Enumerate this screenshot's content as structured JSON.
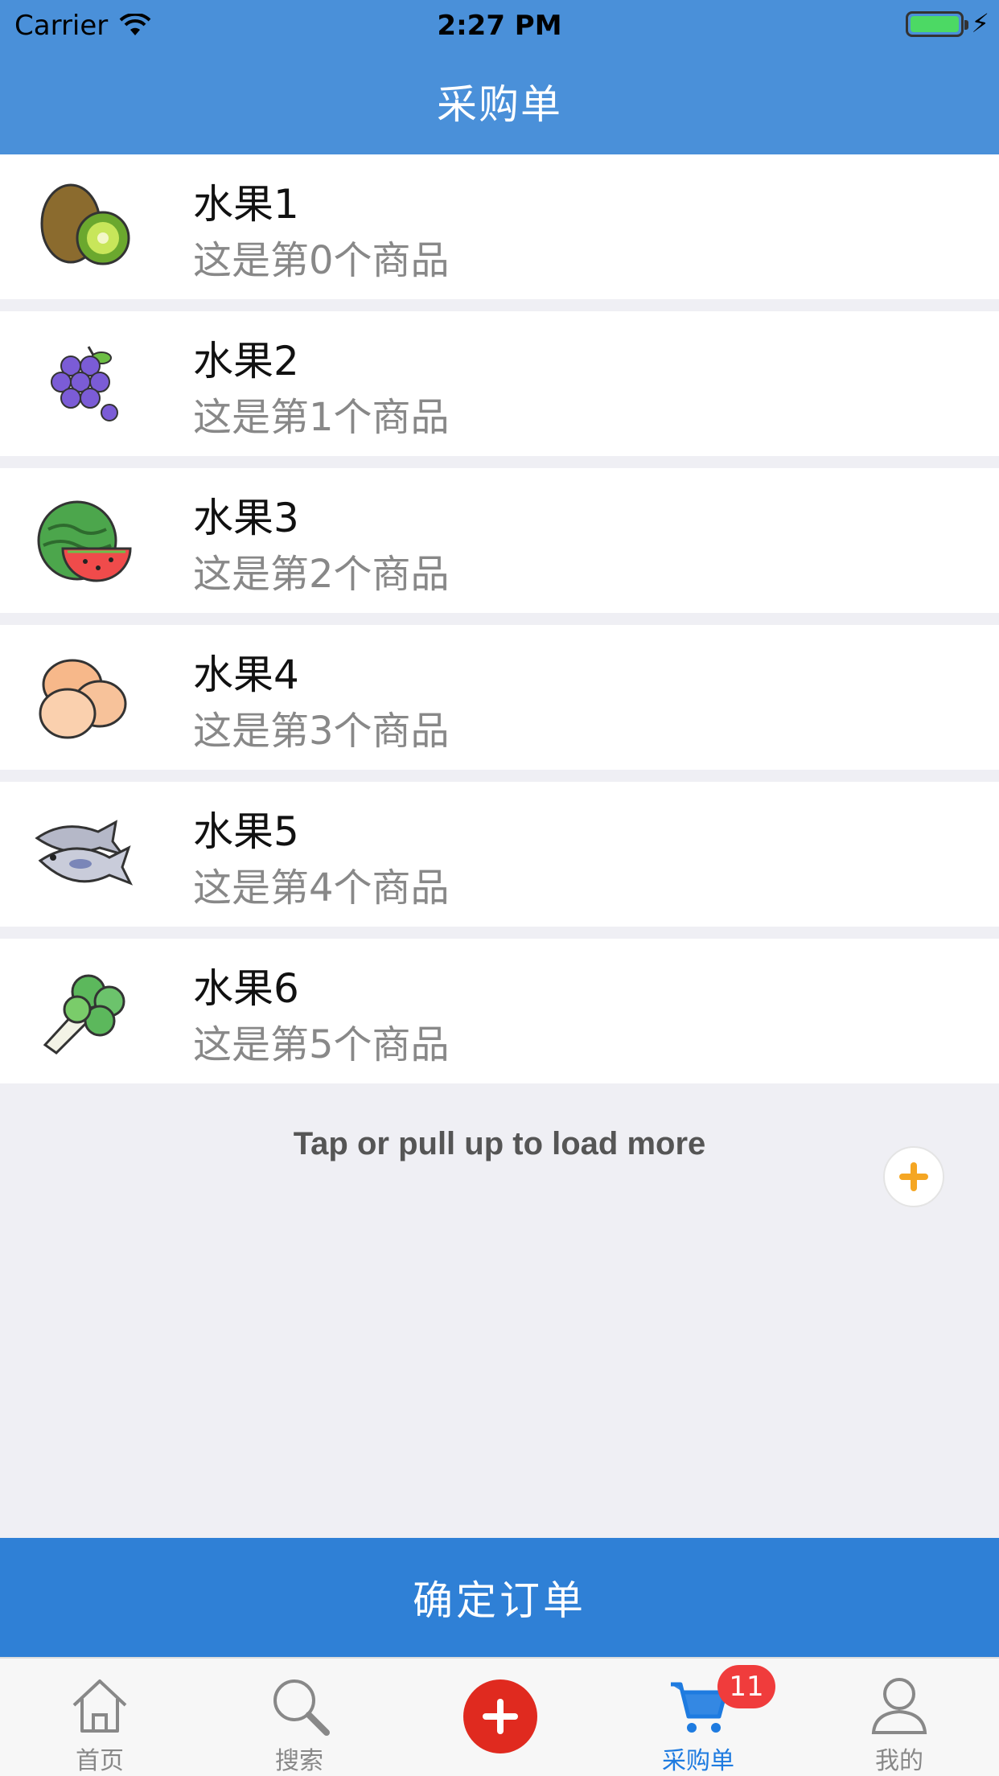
{
  "status_bar": {
    "carrier": "Carrier",
    "time": "2:27 PM"
  },
  "nav": {
    "title": "采购单"
  },
  "items": [
    {
      "name": "水果1",
      "desc": "这是第0个商品",
      "icon": "kiwi-icon"
    },
    {
      "name": "水果2",
      "desc": "这是第1个商品",
      "icon": "grape-icon"
    },
    {
      "name": "水果3",
      "desc": "这是第2个商品",
      "icon": "watermelon-icon"
    },
    {
      "name": "水果4",
      "desc": "这是第3个商品",
      "icon": "egg-icon"
    },
    {
      "name": "水果5",
      "desc": "这是第4个商品",
      "icon": "fish-icon"
    },
    {
      "name": "水果6",
      "desc": "这是第5个商品",
      "icon": "cabbage-icon"
    }
  ],
  "load_more": "Tap or pull up to load more",
  "confirm_label": "确定订单",
  "tabs": [
    {
      "label": "首页",
      "icon": "home-icon"
    },
    {
      "label": "搜索",
      "icon": "search-icon"
    },
    {
      "label": "",
      "icon": "add-icon"
    },
    {
      "label": "采购单",
      "icon": "cart-icon",
      "badge": "11",
      "active": true
    },
    {
      "label": "我的",
      "icon": "user-icon"
    }
  ],
  "colors": {
    "nav": "#4A90D9",
    "confirm": "#2F80D6",
    "accent_orange": "#F5A623",
    "center_red": "#E02A1F",
    "active_tab": "#1E7BE0",
    "badge": "#F03C3C"
  }
}
